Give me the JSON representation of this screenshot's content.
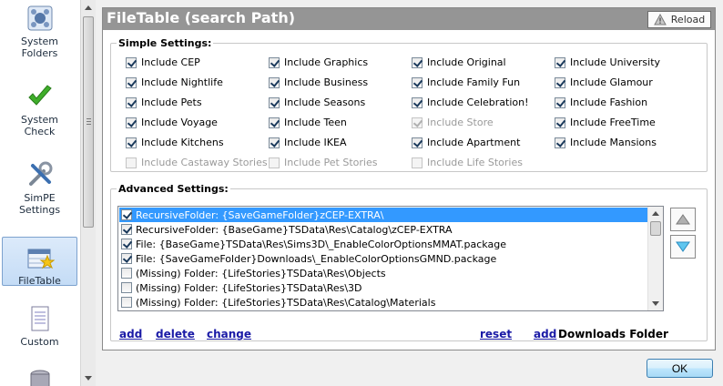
{
  "nav": {
    "items": [
      {
        "label": "System\nFolders",
        "icon": "system-folders-icon"
      },
      {
        "label": "System\nCheck",
        "icon": "green-check-icon"
      },
      {
        "label": "SimPE\nSettings",
        "icon": "tools-icon"
      },
      {
        "label": "FileTable",
        "icon": "filetable-icon",
        "selected": true
      },
      {
        "label": "Custom",
        "icon": "document-icon"
      }
    ]
  },
  "panel": {
    "title": "FileTable (search Path)",
    "reload_label": "Reload"
  },
  "simple": {
    "legend": "Simple Settings:",
    "columns": [
      [
        {
          "label": "Include CEP",
          "checked": true,
          "enabled": true
        },
        {
          "label": "Include Nightlife",
          "checked": true,
          "enabled": true
        },
        {
          "label": "Include Pets",
          "checked": true,
          "enabled": true
        },
        {
          "label": "Include Voyage",
          "checked": true,
          "enabled": true
        },
        {
          "label": "Include Kitchens",
          "checked": true,
          "enabled": true
        },
        {
          "label": "Include Castaway Stories",
          "checked": false,
          "enabled": false
        }
      ],
      [
        {
          "label": "Include Graphics",
          "checked": true,
          "enabled": true
        },
        {
          "label": "Include Business",
          "checked": true,
          "enabled": true
        },
        {
          "label": "Include Seasons",
          "checked": true,
          "enabled": true
        },
        {
          "label": "Include Teen",
          "checked": true,
          "enabled": true
        },
        {
          "label": "Include IKEA",
          "checked": true,
          "enabled": true
        },
        {
          "label": "Include Pet Stories",
          "checked": false,
          "enabled": false
        }
      ],
      [
        {
          "label": "Include Original",
          "checked": true,
          "enabled": true
        },
        {
          "label": "Include Family Fun",
          "checked": true,
          "enabled": true
        },
        {
          "label": "Include Celebration!",
          "checked": true,
          "enabled": true
        },
        {
          "label": "Include Store",
          "checked": true,
          "enabled": false
        },
        {
          "label": "Include Apartment",
          "checked": true,
          "enabled": true
        },
        {
          "label": "Include Life Stories",
          "checked": false,
          "enabled": false
        }
      ],
      [
        {
          "label": "Include University",
          "checked": true,
          "enabled": true
        },
        {
          "label": "Include Glamour",
          "checked": true,
          "enabled": true
        },
        {
          "label": "Include Fashion",
          "checked": true,
          "enabled": true
        },
        {
          "label": "Include FreeTime",
          "checked": true,
          "enabled": true
        },
        {
          "label": "Include Mansions",
          "checked": true,
          "enabled": true
        }
      ]
    ]
  },
  "advanced": {
    "legend": "Advanced Settings:",
    "rows": [
      {
        "text": "RecursiveFolder: {SaveGameFolder}zCEP-EXTRA\\",
        "checked": true,
        "selected": true
      },
      {
        "text": "RecursiveFolder: {BaseGame}TSData\\Res\\Catalog\\zCEP-EXTRA",
        "checked": true,
        "selected": false
      },
      {
        "text": "File: {BaseGame}TSData\\Res\\Sims3D\\_EnableColorOptionsMMAT.package",
        "checked": true,
        "selected": false
      },
      {
        "text": "File: {SaveGameFolder}Downloads\\_EnableColorOptionsGMND.package",
        "checked": true,
        "selected": false
      },
      {
        "text": "(Missing) Folder: {LifeStories}TSData\\Res\\Objects",
        "checked": false,
        "selected": false
      },
      {
        "text": "(Missing) Folder: {LifeStories}TSData\\Res\\3D",
        "checked": false,
        "selected": false
      },
      {
        "text": "(Missing) Folder: {LifeStories}TSData\\Res\\Catalog\\Materials",
        "checked": false,
        "selected": false
      }
    ],
    "links": {
      "add": "add",
      "delete": "delete",
      "change": "change",
      "reset": "reset",
      "add_downloads": "add",
      "downloads_folder": "Downloads Folder"
    }
  },
  "ok_label": "OK",
  "colors": {
    "title_bar": "#959595",
    "selection": "#3399ff",
    "link": "#1a1aa6"
  }
}
